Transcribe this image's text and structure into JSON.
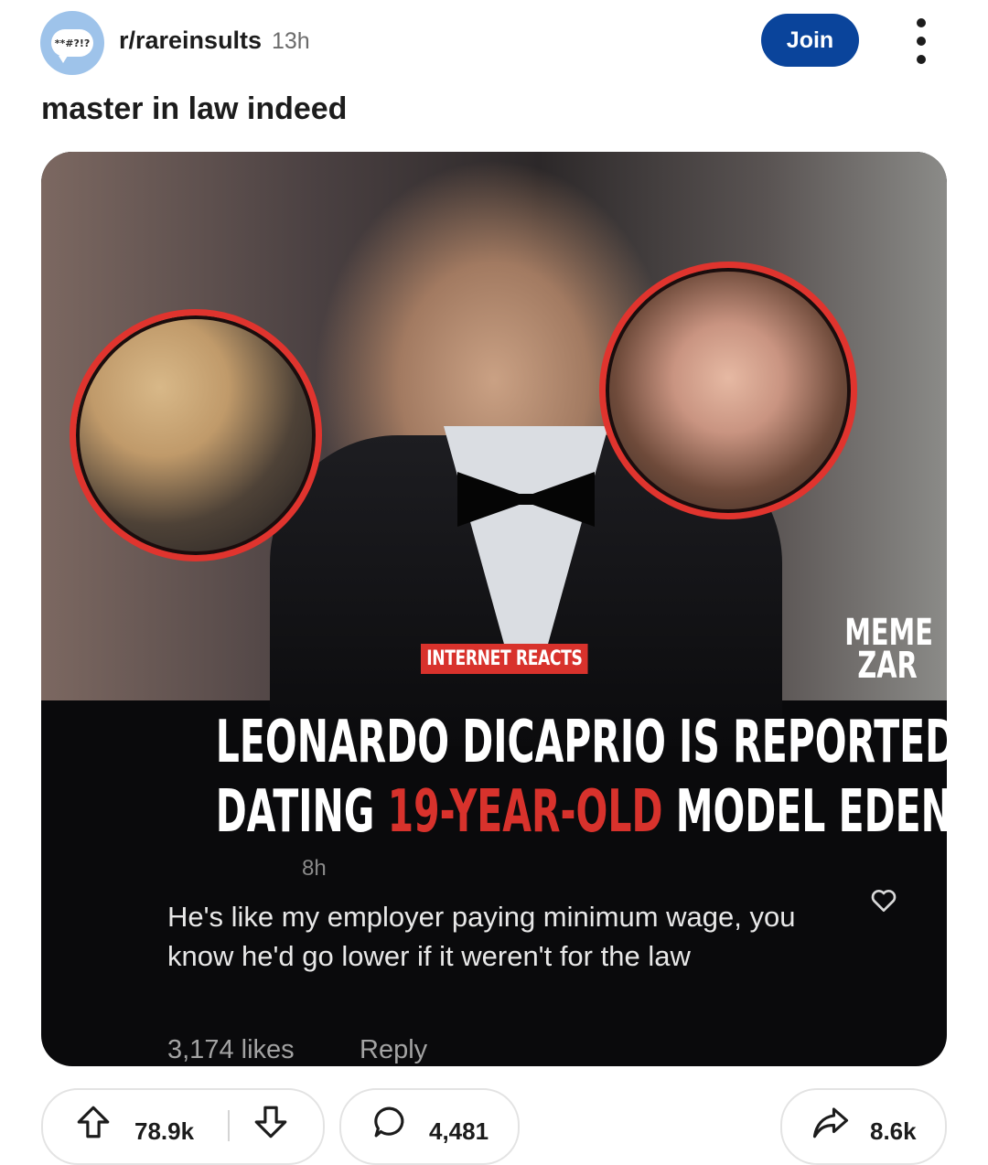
{
  "header": {
    "avatar_text": "**#?!?",
    "subreddit": "r/rareinsults",
    "age": "13h",
    "join_label": "Join"
  },
  "post": {
    "title": "master in law indeed"
  },
  "image": {
    "tag": "INTERNET REACTS",
    "logo_top": "MEME",
    "logo_bottom": "ZAR",
    "headline_line1": "LEONARDO DICAPRIO IS REPORTEDLY",
    "headline_line2_pre": "DATING ",
    "headline_line2_highlight": "19-YEAR-OLD",
    "headline_line2_post": " MODEL EDEN POLANI",
    "highlight_color": "#d8322c",
    "comment_time": "8h",
    "comment_text": "He's like my employer paying minimum wage, you know he'd go lower if it weren't for the law",
    "comment_likes": "3,174 likes",
    "comment_reply": "Reply"
  },
  "actions": {
    "upvotes": "78.9k",
    "comments": "4,481",
    "shares": "8.6k"
  },
  "colors": {
    "join_bg": "#0a449b",
    "avatar_bg": "#9ec3ea"
  }
}
